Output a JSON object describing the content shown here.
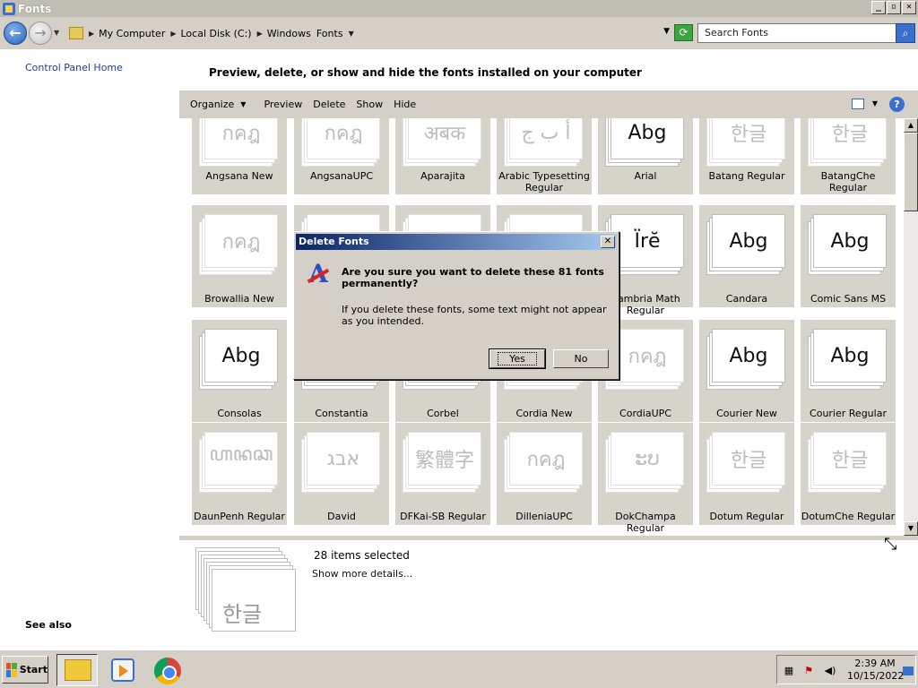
{
  "window": {
    "title": "Fonts"
  },
  "address": {
    "crumbs": [
      "My Computer",
      "Local Disk (C:)",
      "Windows",
      "Fonts"
    ],
    "search_placeholder": "Search Fonts"
  },
  "left_panel": {
    "home_link": "Control Panel Home",
    "see_also": "See also"
  },
  "heading": "Preview, delete, or show and hide the fonts installed on your computer",
  "toolbar": {
    "organize": "Organize",
    "preview": "Preview",
    "delete": "Delete",
    "show": "Show",
    "hide": "Hide"
  },
  "fonts": [
    {
      "name": "Angsana New",
      "sample": "กคฎ",
      "faded": true
    },
    {
      "name": "AngsanaUPC",
      "sample": "กคฎ",
      "faded": true
    },
    {
      "name": "Aparajita",
      "sample": "अबक",
      "faded": true
    },
    {
      "name": "Arabic Typesetting Regular",
      "sample": "أ ب ج",
      "faded": true
    },
    {
      "name": "Arial",
      "sample": "Abg",
      "faded": false
    },
    {
      "name": "Batang Regular",
      "sample": "한글",
      "faded": true
    },
    {
      "name": "BatangChe Regular",
      "sample": "한글",
      "faded": true
    },
    {
      "name": "Browallia New",
      "sample": "กคฎ",
      "faded": true
    },
    {
      "name": "",
      "sample": "",
      "faded": true
    },
    {
      "name": "",
      "sample": "",
      "faded": true
    },
    {
      "name": "",
      "sample": "",
      "faded": true
    },
    {
      "name": "Cambria Math Regular",
      "sample": "Ïrĕ",
      "faded": false
    },
    {
      "name": "Candara",
      "sample": "Abg",
      "faded": false
    },
    {
      "name": "Comic Sans MS",
      "sample": "Abg",
      "faded": false
    },
    {
      "name": "Consolas",
      "sample": "Abg",
      "faded": false
    },
    {
      "name": "Constantia",
      "sample": "",
      "faded": false
    },
    {
      "name": "Corbel",
      "sample": "",
      "faded": false
    },
    {
      "name": "Cordia New",
      "sample": "",
      "faded": true
    },
    {
      "name": "CordiaUPC",
      "sample": "กคฎ",
      "faded": true
    },
    {
      "name": "Courier New",
      "sample": "Abg",
      "faded": false
    },
    {
      "name": "Courier Regular",
      "sample": "Abg",
      "faded": false
    },
    {
      "name": "DaunPenh Regular",
      "sample": "ꦲꦤꦕ",
      "faded": true
    },
    {
      "name": "David",
      "sample": "אבג",
      "faded": true
    },
    {
      "name": "DFKai-SB Regular",
      "sample": "繁體字",
      "faded": true
    },
    {
      "name": "DilleniaUPC",
      "sample": "กคฎ",
      "faded": true
    },
    {
      "name": "DokChampa Regular",
      "sample": "ະບ",
      "faded": true
    },
    {
      "name": "Dotum Regular",
      "sample": "한글",
      "faded": true
    },
    {
      "name": "DotumChe Regular",
      "sample": "한글",
      "faded": true
    }
  ],
  "details": {
    "count": "28 items selected",
    "more": "Show more details...",
    "sample": "한글"
  },
  "dialog": {
    "title": "Delete Fonts",
    "message": "Are you sure you want to delete these 81 fonts permanently?",
    "sub": "If you delete these fonts, some text might not appear as you intended.",
    "yes": "Yes",
    "no": "No"
  },
  "taskbar": {
    "start": "Start",
    "time": "2:39 AM",
    "date": "10/15/2022"
  },
  "icons": {
    "back": "back-arrow-icon",
    "forward": "forward-arrow-icon",
    "refresh": "refresh-icon",
    "search": "search-icon",
    "help": "help-icon",
    "dialog": "font-delete-icon"
  }
}
